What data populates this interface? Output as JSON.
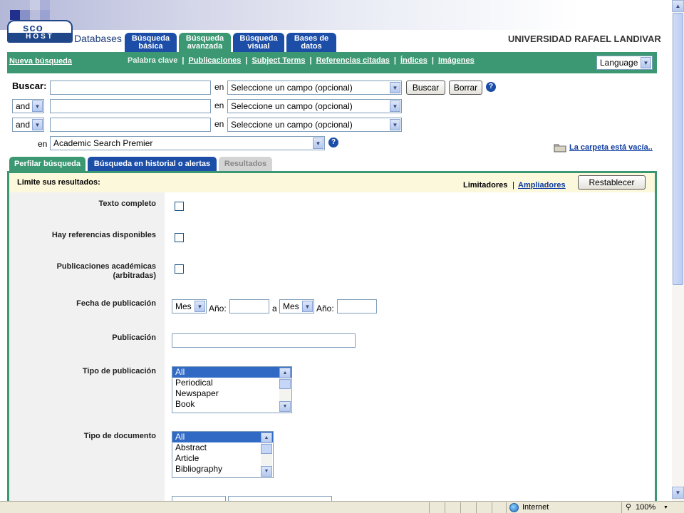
{
  "header": {
    "logo_top": "sco",
    "logo_bottom": "HOST",
    "databases_label": "Databases",
    "tabs": [
      {
        "label": "Búsqueda básica",
        "line1": "Búsqueda",
        "line2": "básica"
      },
      {
        "label": "Búsqueda avanzada",
        "line1": "Búsqueda",
        "line2": "avanzada"
      },
      {
        "label": "Búsqueda visual",
        "line1": "Búsqueda",
        "line2": "visual"
      },
      {
        "label": "Bases de datos",
        "line1": "Bases de",
        "line2": "datos"
      }
    ],
    "institution": "UNIVERSIDAD RAFAEL LANDIVAR"
  },
  "nav": {
    "new_search": "Nueva búsqueda",
    "items": [
      "Palabra clave",
      "Publicaciones",
      "Subject Terms",
      "Referencias citadas",
      "Índices",
      "Imágenes"
    ],
    "separator": "|",
    "language": "Language"
  },
  "search": {
    "label": "Buscar:",
    "in_label": "en",
    "field_placeholder": "Seleccione un campo (opcional)",
    "operator": "and",
    "search_button": "Buscar",
    "clear_button": "Borrar",
    "db_in_label": "en",
    "database": "Academic Search Premier",
    "help": "?",
    "folder_text": "La carpeta está vacía.."
  },
  "section_tabs": [
    "Perfilar búsqueda",
    "Búsqueda en historial o alertas",
    "Resultados"
  ],
  "limits": {
    "title": "Limite sus resultados:",
    "limiters": "Limitadores",
    "separator": "|",
    "expanders": "Ampliadores",
    "reset": "Restablecer",
    "full_text": "Texto completo",
    "references": "Hay referencias disponibles",
    "scholarly_1": "Publicaciones académicas",
    "scholarly_2": "(arbitradas)",
    "pub_date": "Fecha de publicación",
    "month": "Mes",
    "year": "Año:",
    "to": "a",
    "publication": "Publicación",
    "pub_type": "Tipo de publicación",
    "pub_type_options": [
      "All",
      "Periodical",
      "Newspaper",
      "Book"
    ],
    "doc_type": "Tipo de documento",
    "doc_type_options": [
      "All",
      "Abstract",
      "Article",
      "Bibliography"
    ]
  },
  "statusbar": {
    "zone": "Internet",
    "zoom": "100%"
  },
  "colors": {
    "green": "#3c9873",
    "blue": "#1c4ea8",
    "limits_bg": "#fcf8dc"
  }
}
